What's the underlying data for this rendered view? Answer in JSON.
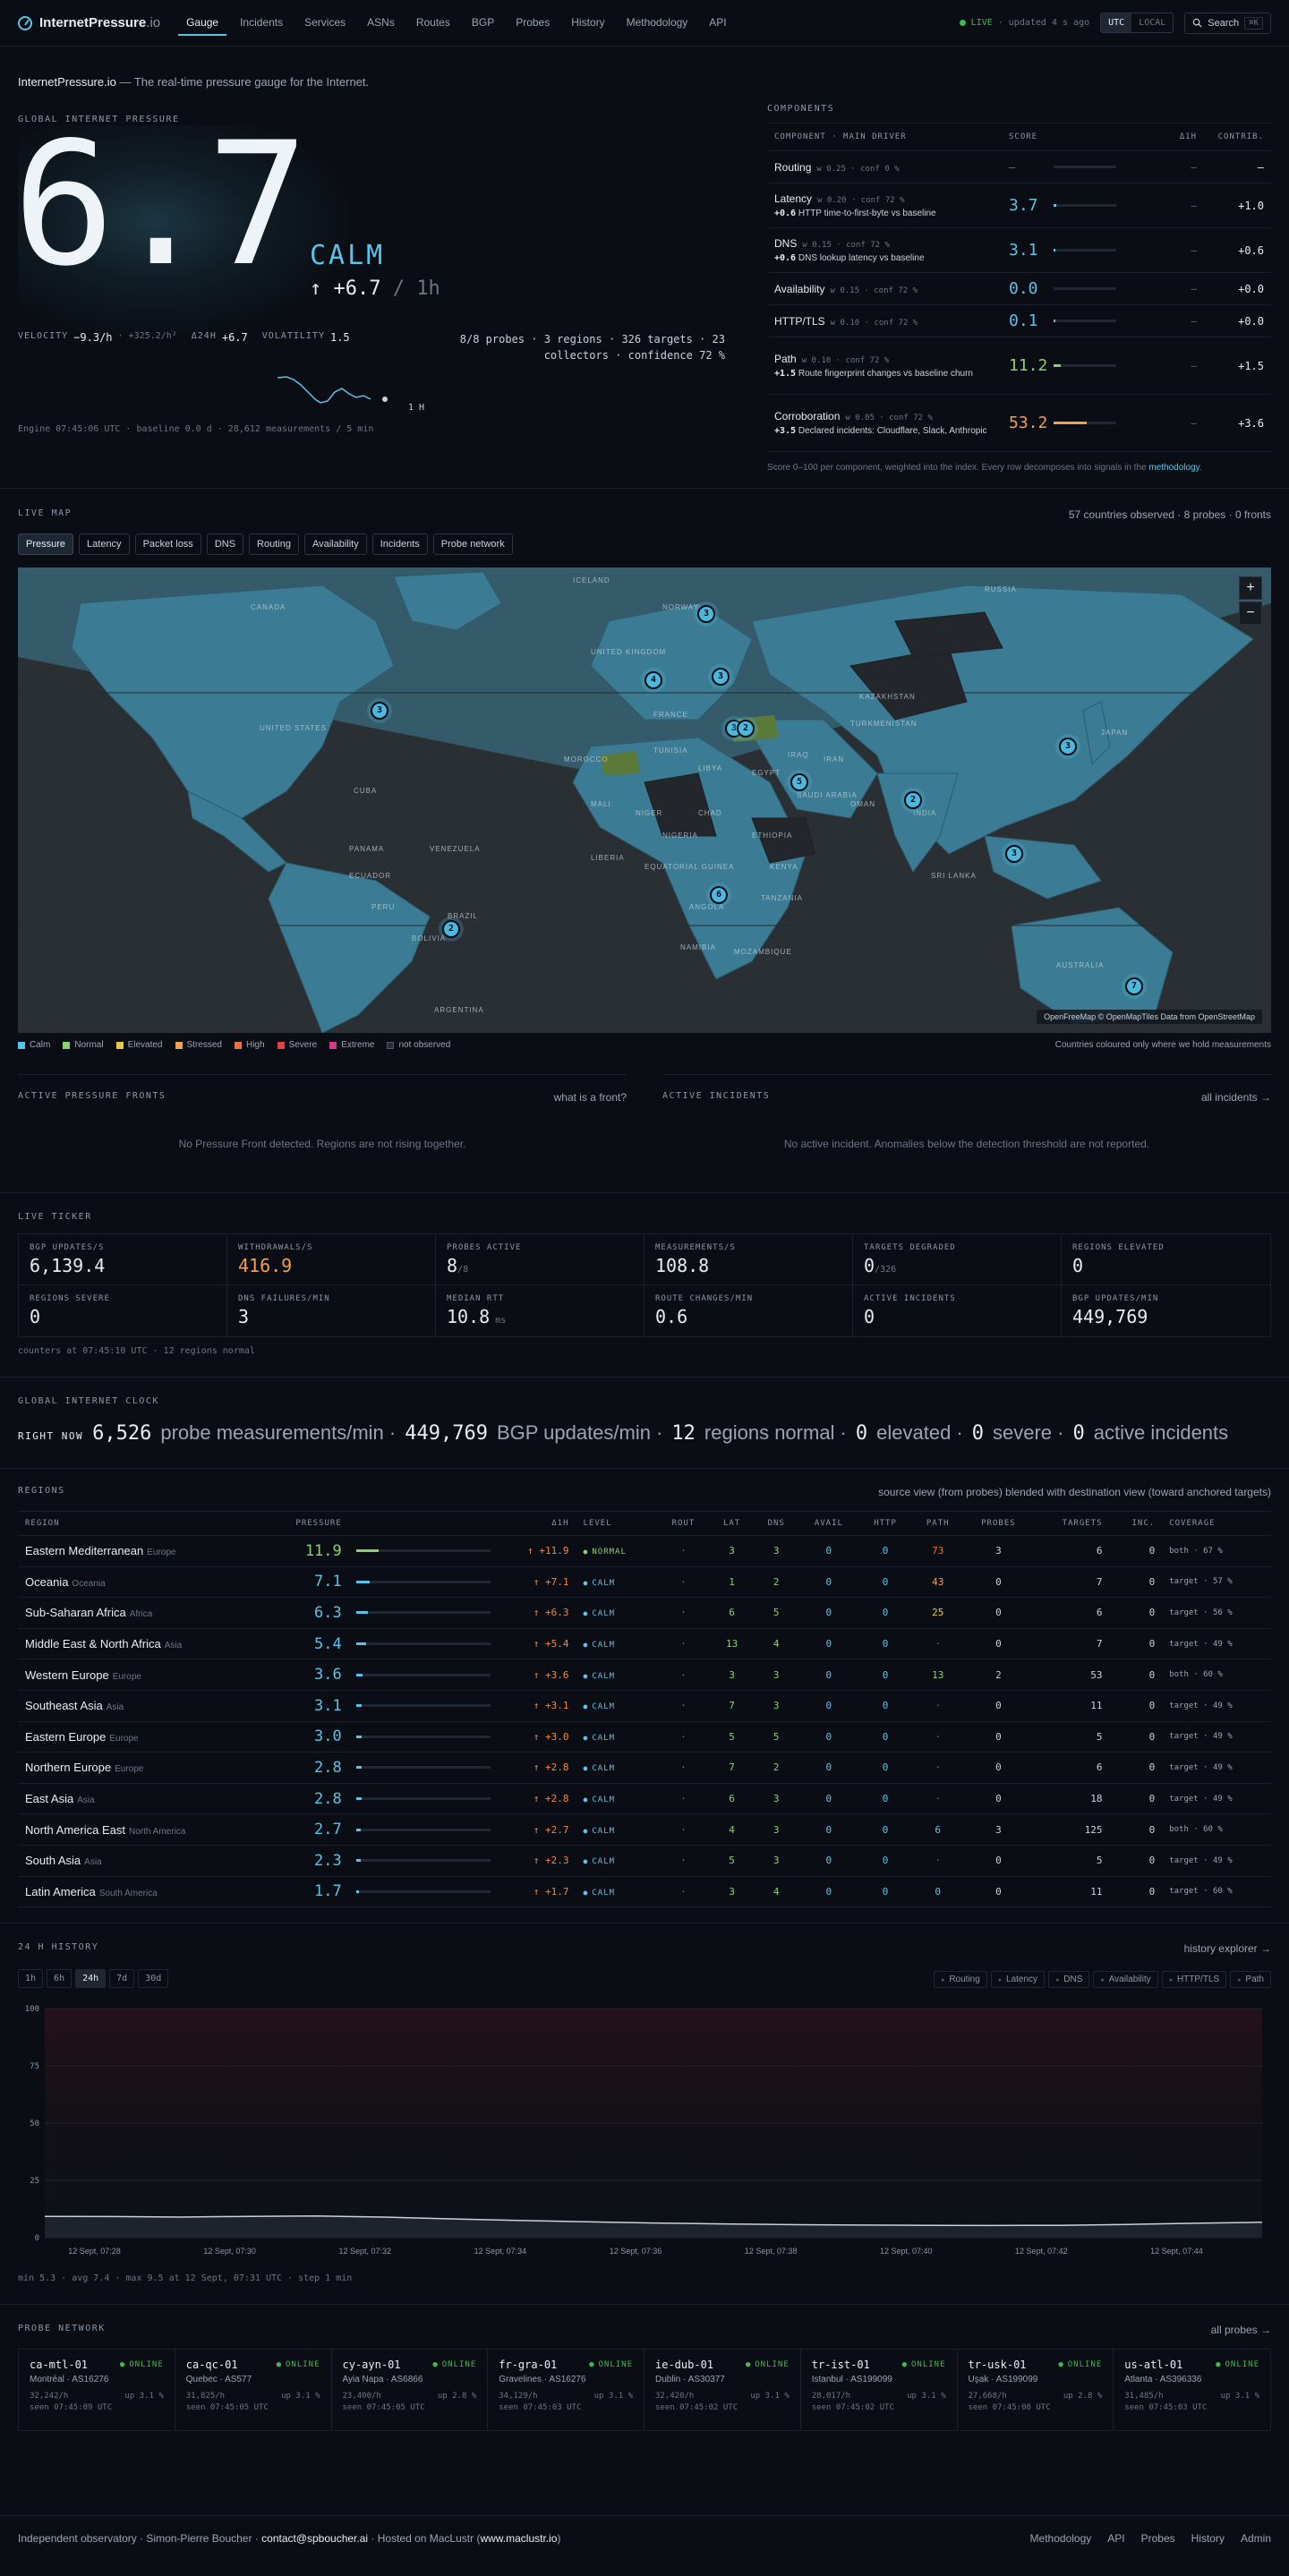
{
  "header": {
    "brand": "InternetPressure",
    "brand_tld": ".io",
    "nav": [
      "Gauge",
      "Incidents",
      "Services",
      "ASNs",
      "Routes",
      "BGP",
      "Probes",
      "History",
      "Methodology",
      "API"
    ],
    "live": "LIVE",
    "updated": "· updated 4 s ago",
    "tz_utc": "UTC",
    "tz_local": "LOCAL",
    "search": "Search",
    "search_kbd": "⌘K"
  },
  "hero": {
    "tagline_brand": "InternetPressure.io",
    "tagline_rest": " — The real-time pressure gauge for the Internet.",
    "title": "GLOBAL INTERNET PRESSURE",
    "score": "6.7",
    "level": "CALM",
    "delta": "↑ +6.7",
    "delta_per": " / 1h",
    "velocity_k": "VELOCITY",
    "velocity_v": "−9.3/h",
    "accel": "· +325.2/h²",
    "d24_k": "Δ24H",
    "d24_v": "+6.7",
    "vol_k": "VOLATILITY",
    "vol_v": "1.5",
    "probes_line1": "8/8 probes · 3 regions · 326 targets · 23",
    "probes_line2": "collectors · confidence 72 %",
    "spark_label": "1 H",
    "engine": "Engine 07:45:06 UTC · baseline 0.0 d · 28,612 measurements / 5 min"
  },
  "components": {
    "title": "COMPONENTS",
    "headers": [
      "COMPONENT · MAIN DRIVER",
      "SCORE",
      "Δ1H",
      "CONTRIB."
    ],
    "rows": [
      {
        "name": "Routing",
        "meta": "w 0.25 · conf 0 %",
        "driver_v": "",
        "driver": "",
        "score": "—",
        "pct": 0,
        "color": "#6b7685",
        "d1h": "—",
        "contrib": "—"
      },
      {
        "name": "Latency",
        "meta": "w 0.20 · conf 72 %",
        "driver_v": "+0.6",
        "driver": " HTTP time-to-first-byte vs baseline",
        "score": "3.7",
        "pct": 3.7,
        "color": "#58c4e8",
        "d1h": "—",
        "contrib": "+1.0"
      },
      {
        "name": "DNS",
        "meta": "w 0.15 · conf 72 %",
        "driver_v": "+0.6",
        "driver": " DNS lookup latency vs baseline",
        "score": "3.1",
        "pct": 3.1,
        "color": "#58c4e8",
        "d1h": "—",
        "contrib": "+0.6"
      },
      {
        "name": "Availability",
        "meta": "w 0.15 · conf 72 %",
        "driver_v": "",
        "driver": "",
        "score": "0.0",
        "pct": 0,
        "color": "#58c4e8",
        "d1h": "—",
        "contrib": "+0.0"
      },
      {
        "name": "HTTP/TLS",
        "meta": "w 0.10 · conf 72 %",
        "driver_v": "",
        "driver": "",
        "score": "0.1",
        "pct": 0.1,
        "color": "#58c4e8",
        "d1h": "—",
        "contrib": "+0.0"
      },
      {
        "name": "Path",
        "meta": "w 0.10 · conf 72 %",
        "driver_v": "+1.5",
        "driver": " Route fingerprint changes vs baseline churn",
        "score": "11.2",
        "pct": 11.2,
        "color": "#8ed06e",
        "d1h": "—",
        "contrib": "+1.5"
      },
      {
        "name": "Corroboration",
        "meta": "w 0.05 · conf 72 %",
        "driver_v": "+3.5",
        "driver": " Declared incidents: Cloudflare, Slack, Anthropic",
        "score": "53.2",
        "pct": 53.2,
        "color": "#f0a050",
        "d1h": "—",
        "contrib": "+3.6"
      }
    ],
    "foot": "Score 0–100 per component, weighted into the index. Every row decomposes into signals in the ",
    "foot_link": "methodology",
    "foot_end": "."
  },
  "map": {
    "title": "LIVE MAP",
    "summary": "57 countries observed · 8 probes · 0 fronts",
    "tabs": [
      "Pressure",
      "Latency",
      "Packet loss",
      "DNS",
      "Routing",
      "Availability",
      "Incidents",
      "Probe network"
    ],
    "labels": [
      "CANADA",
      "UNITED STATES",
      "CUBA",
      "PANAMA",
      "VENEZUELA",
      "ECUADOR",
      "PERU",
      "BRAZIL",
      "BOLIVIA",
      "ARGENTINA",
      "ICELAND",
      "UNITED KINGDOM",
      "NORWAY",
      "FRANCE",
      "TUNISIA",
      "MOROCCO",
      "LIBYA",
      "EGYPT",
      "NIGER",
      "CHAD",
      "MALI",
      "NIGERIA",
      "ETHIOPIA",
      "KENYA",
      "TANZANIA",
      "ANGOLA",
      "NAMIBIA",
      "MOZAMBIQUE",
      "LIBERIA",
      "EQUATORIAL GUINEA",
      "SAUDI ARABIA",
      "IRAN",
      "IRAQ",
      "OMAN",
      "TURKMENISTAN",
      "KAZAKHSTAN",
      "RUSSIA",
      "INDIA",
      "SRI LANKA",
      "JAPAN",
      "AUSTRALIA"
    ],
    "clusters": [
      "3",
      "4",
      "3",
      "3",
      "3",
      "2",
      "5",
      "2",
      "6",
      "2",
      "3",
      "3",
      "7"
    ],
    "zoom_in": "+",
    "zoom_out": "−",
    "attribution": "OpenFreeMap © OpenMapTiles Data from OpenStreetMap",
    "legend": [
      {
        "label": "Calm",
        "color": "#58c4e8"
      },
      {
        "label": "Normal",
        "color": "#8ed06e"
      },
      {
        "label": "Elevated",
        "color": "#e8c84a"
      },
      {
        "label": "Stressed",
        "color": "#f0a050"
      },
      {
        "label": "High",
        "color": "#e8733a"
      },
      {
        "label": "Severe",
        "color": "#e04040"
      },
      {
        "label": "Extreme",
        "color": "#d43a8a"
      },
      {
        "label": "not observed",
        "color": "#2a2f34"
      }
    ],
    "legend_note": "Countries coloured only where we hold measurements"
  },
  "fronts": {
    "title": "ACTIVE PRESSURE FRONTS",
    "link": "what is a front?",
    "empty": "No Pressure Front detected. Regions are not rising together."
  },
  "incidents": {
    "title": "ACTIVE INCIDENTS",
    "link": "all incidents →",
    "empty": "No active incident. Anomalies below the detection threshold are not reported."
  },
  "ticker": {
    "title": "LIVE TICKER",
    "cells": [
      {
        "k": "BGP UPDATES/S",
        "v": "6,139.4",
        "s": "",
        "color": "#e6edf3"
      },
      {
        "k": "WITHDRAWALS/S",
        "v": "416.9",
        "s": "",
        "color": "#f0a050"
      },
      {
        "k": "PROBES ACTIVE",
        "v": "8",
        "s": "/8",
        "color": "#e6edf3"
      },
      {
        "k": "MEASUREMENTS/S",
        "v": "108.8",
        "s": "",
        "color": "#e6edf3"
      },
      {
        "k": "TARGETS DEGRADED",
        "v": "0",
        "s": "/326",
        "color": "#e6edf3"
      },
      {
        "k": "REGIONS ELEVATED",
        "v": "0",
        "s": "",
        "color": "#e6edf3"
      },
      {
        "k": "REGIONS SEVERE",
        "v": "0",
        "s": "",
        "color": "#e6edf3"
      },
      {
        "k": "DNS FAILURES/MIN",
        "v": "3",
        "s": "",
        "color": "#e6edf3"
      },
      {
        "k": "MEDIAN RTT",
        "v": "10.8",
        "s": " ms",
        "color": "#e6edf3"
      },
      {
        "k": "ROUTE CHANGES/MIN",
        "v": "0.6",
        "s": "",
        "color": "#e6edf3"
      },
      {
        "k": "ACTIVE INCIDENTS",
        "v": "0",
        "s": "",
        "color": "#e6edf3"
      },
      {
        "k": "BGP UPDATES/MIN",
        "v": "449,769",
        "s": "",
        "color": "#e6edf3"
      }
    ],
    "foot": "counters at 07:45:10 UTC · 12 regions normal"
  },
  "clock": {
    "title": "GLOBAL INTERNET CLOCK",
    "k": "RIGHT NOW",
    "parts": [
      {
        "n": "6,526",
        "t": "probe measurements/min ·"
      },
      {
        "n": "449,769",
        "t": "BGP updates/min ·"
      },
      {
        "n": "12",
        "t": "regions normal ·"
      },
      {
        "n": "0",
        "t": "elevated ·"
      },
      {
        "n": "0",
        "t": "severe ·"
      },
      {
        "n": "0",
        "t": "active incidents"
      }
    ]
  },
  "regions": {
    "title": "REGIONS",
    "note": "source view (from probes) blended with destination view (toward anchored targets)",
    "headers": [
      "REGION",
      "PRESSURE",
      "",
      "Δ1H",
      "LEVEL",
      "ROUT",
      "LAT",
      "DNS",
      "AVAIL",
      "HTTP",
      "PATH",
      "PROBES",
      "TARGETS",
      "INC.",
      "COVERAGE"
    ],
    "rows": [
      {
        "name": "Eastern Mediterranean",
        "sub": "Europe",
        "p": "11.9",
        "pv": 11.9,
        "pc": "#8ed06e",
        "d": "↑ +11.9",
        "lvl": "NORMAL",
        "lc": "#8ed06e",
        "rout": "·",
        "lat": "3",
        "dns": "3",
        "avail": "0",
        "http": "0",
        "path": "73",
        "pathc": "#e8733a",
        "probes": "3",
        "targets": "6",
        "inc": "0",
        "cov": "both · 67 %"
      },
      {
        "name": "Oceania",
        "sub": "Oceania",
        "p": "7.1",
        "pv": 7.1,
        "pc": "#58c4e8",
        "d": "↑ +7.1",
        "lvl": "CALM",
        "lc": "#58c4e8",
        "rout": "·",
        "lat": "1",
        "dns": "2",
        "avail": "0",
        "http": "0",
        "path": "43",
        "pathc": "#f0a050",
        "probes": "0",
        "targets": "7",
        "inc": "0",
        "cov": "target · 57 %"
      },
      {
        "name": "Sub-Saharan Africa",
        "sub": "Africa",
        "p": "6.3",
        "pv": 6.3,
        "pc": "#58c4e8",
        "d": "↑ +6.3",
        "lvl": "CALM",
        "lc": "#58c4e8",
        "rout": "·",
        "lat": "6",
        "dns": "5",
        "avail": "0",
        "http": "0",
        "path": "25",
        "pathc": "#e8c84a",
        "probes": "0",
        "targets": "6",
        "inc": "0",
        "cov": "target · 56 %"
      },
      {
        "name": "Middle East & North Africa",
        "sub": "Asia",
        "p": "5.4",
        "pv": 5.4,
        "pc": "#58c4e8",
        "d": "↑ +5.4",
        "lvl": "CALM",
        "lc": "#58c4e8",
        "rout": "·",
        "lat": "13",
        "dns": "4",
        "avail": "0",
        "http": "0",
        "path": "·",
        "pathc": "#6b7685",
        "probes": "0",
        "targets": "7",
        "inc": "0",
        "cov": "target · 49 %"
      },
      {
        "name": "Western Europe",
        "sub": "Europe",
        "p": "3.6",
        "pv": 3.6,
        "pc": "#58c4e8",
        "d": "↑ +3.6",
        "lvl": "CALM",
        "lc": "#58c4e8",
        "rout": "·",
        "lat": "3",
        "dns": "3",
        "avail": "0",
        "http": "0",
        "path": "13",
        "pathc": "#8ed06e",
        "probes": "2",
        "targets": "53",
        "inc": "0",
        "cov": "both · 60 %"
      },
      {
        "name": "Southeast Asia",
        "sub": "Asia",
        "p": "3.1",
        "pv": 3.1,
        "pc": "#58c4e8",
        "d": "↑ +3.1",
        "lvl": "CALM",
        "lc": "#58c4e8",
        "rout": "·",
        "lat": "7",
        "dns": "3",
        "avail": "0",
        "http": "0",
        "path": "·",
        "pathc": "#6b7685",
        "probes": "0",
        "targets": "11",
        "inc": "0",
        "cov": "target · 49 %"
      },
      {
        "name": "Eastern Europe",
        "sub": "Europe",
        "p": "3.0",
        "pv": 3.0,
        "pc": "#58c4e8",
        "d": "↑ +3.0",
        "lvl": "CALM",
        "lc": "#58c4e8",
        "rout": "·",
        "lat": "5",
        "dns": "5",
        "avail": "0",
        "http": "0",
        "path": "·",
        "pathc": "#6b7685",
        "probes": "0",
        "targets": "5",
        "inc": "0",
        "cov": "target · 49 %"
      },
      {
        "name": "Northern Europe",
        "sub": "Europe",
        "p": "2.8",
        "pv": 2.8,
        "pc": "#58c4e8",
        "d": "↑ +2.8",
        "lvl": "CALM",
        "lc": "#58c4e8",
        "rout": "·",
        "lat": "7",
        "dns": "2",
        "avail": "0",
        "http": "0",
        "path": "·",
        "pathc": "#6b7685",
        "probes": "0",
        "targets": "6",
        "inc": "0",
        "cov": "target · 49 %"
      },
      {
        "name": "East Asia",
        "sub": "Asia",
        "p": "2.8",
        "pv": 2.8,
        "pc": "#58c4e8",
        "d": "↑ +2.8",
        "lvl": "CALM",
        "lc": "#58c4e8",
        "rout": "·",
        "lat": "6",
        "dns": "3",
        "avail": "0",
        "http": "0",
        "path": "·",
        "pathc": "#6b7685",
        "probes": "0",
        "targets": "18",
        "inc": "0",
        "cov": "target · 49 %"
      },
      {
        "name": "North America East",
        "sub": "North America",
        "p": "2.7",
        "pv": 2.7,
        "pc": "#58c4e8",
        "d": "↑ +2.7",
        "lvl": "CALM",
        "lc": "#58c4e8",
        "rout": "·",
        "lat": "4",
        "dns": "3",
        "avail": "0",
        "http": "0",
        "path": "6",
        "pathc": "#58c4e8",
        "probes": "3",
        "targets": "125",
        "inc": "0",
        "cov": "both · 60 %"
      },
      {
        "name": "South Asia",
        "sub": "Asia",
        "p": "2.3",
        "pv": 2.3,
        "pc": "#58c4e8",
        "d": "↑ +2.3",
        "lvl": "CALM",
        "lc": "#58c4e8",
        "rout": "·",
        "lat": "5",
        "dns": "3",
        "avail": "0",
        "http": "0",
        "path": "·",
        "pathc": "#6b7685",
        "probes": "0",
        "targets": "5",
        "inc": "0",
        "cov": "target · 49 %"
      },
      {
        "name": "Latin America",
        "sub": "South America",
        "p": "1.7",
        "pv": 1.7,
        "pc": "#58c4e8",
        "d": "↑ +1.7",
        "lvl": "CALM",
        "lc": "#58c4e8",
        "rout": "·",
        "lat": "3",
        "dns": "4",
        "avail": "0",
        "http": "0",
        "path": "0",
        "pathc": "#58c4e8",
        "probes": "0",
        "targets": "11",
        "inc": "0",
        "cov": "target · 60 %"
      }
    ]
  },
  "history": {
    "title": "24 H HISTORY",
    "link": "history explorer →",
    "ranges": [
      "1h",
      "6h",
      "24h",
      "7d",
      "30d"
    ],
    "active_range": "24h",
    "series": [
      "Routing",
      "Latency",
      "DNS",
      "Availability",
      "HTTP/TLS",
      "Path"
    ],
    "foot": "min 5.3 · avg 7.4 · max 9.5 at 12 Sept, 07:31 UTC · step 1 min"
  },
  "chart_data": {
    "type": "line",
    "ylim": [
      0,
      100
    ],
    "yticks": [
      "0",
      "25",
      "50",
      "75",
      "100"
    ],
    "xticks": [
      "12 Sept, 07:28",
      "12 Sept, 07:30",
      "12 Sept, 07:32",
      "12 Sept, 07:34",
      "12 Sept, 07:36",
      "12 Sept, 07:38",
      "12 Sept, 07:40",
      "12 Sept, 07:42",
      "12 Sept, 07:44"
    ],
    "x": [
      "07:27",
      "07:28",
      "07:29",
      "07:30",
      "07:31",
      "07:32",
      "07:33",
      "07:34",
      "07:35",
      "07:36",
      "07:37",
      "07:38",
      "07:39",
      "07:40",
      "07:41",
      "07:42",
      "07:43",
      "07:44",
      "07:45"
    ],
    "series": [
      {
        "values": [
          9.3,
          9.2,
          9.0,
          9.3,
          9.5,
          9.0,
          8.2,
          7.5,
          6.9,
          6.4,
          6.0,
          5.7,
          5.5,
          5.4,
          5.3,
          5.4,
          5.8,
          6.3,
          6.7
        ]
      }
    ]
  },
  "probes": {
    "title": "PROBE NETWORK",
    "link": "all probes →",
    "items": [
      {
        "id": "ca-mtl-01",
        "status": "ONLINE",
        "loc": "Montréal · AS16276",
        "rate": "32,242/h",
        "up": "up 3.1 %",
        "seen": "seen 07:45:09 UTC"
      },
      {
        "id": "ca-qc-01",
        "status": "ONLINE",
        "loc": "Quebec · AS577",
        "rate": "31,825/h",
        "up": "up 3.1 %",
        "seen": "seen 07:45:05 UTC"
      },
      {
        "id": "cy-ayn-01",
        "status": "ONLINE",
        "loc": "Ayia Napa · AS6866",
        "rate": "23,400/h",
        "up": "up 2.8 %",
        "seen": "seen 07:45:05 UTC"
      },
      {
        "id": "fr-gra-01",
        "status": "ONLINE",
        "loc": "Gravelines · AS16276",
        "rate": "34,129/h",
        "up": "up 3.1 %",
        "seen": "seen 07:45:03 UTC"
      },
      {
        "id": "ie-dub-01",
        "status": "ONLINE",
        "loc": "Dublin · AS30377",
        "rate": "32,420/h",
        "up": "up 3.1 %",
        "seen": "seen 07:45:02 UTC"
      },
      {
        "id": "tr-ist-01",
        "status": "ONLINE",
        "loc": "Istanbul · AS199099",
        "rate": "28,017/h",
        "up": "up 3.1 %",
        "seen": "seen 07:45:02 UTC"
      },
      {
        "id": "tr-usk-01",
        "status": "ONLINE",
        "loc": "Uşak · AS199099",
        "rate": "27,668/h",
        "up": "up 2.8 %",
        "seen": "seen 07:45:08 UTC"
      },
      {
        "id": "us-atl-01",
        "status": "ONLINE",
        "loc": "Atlanta · AS396336",
        "rate": "31,485/h",
        "up": "up 3.1 %",
        "seen": "seen 07:45:03 UTC"
      }
    ]
  },
  "footer": {
    "left": "Independent observatory · Simon-Pierre Boucher · ",
    "email": "contact@spboucher.ai",
    "mid": " · Hosted on MacLustr (",
    "host": "www.maclustr.io",
    "end": ")",
    "links": [
      "Methodology",
      "API",
      "Probes",
      "History",
      "Admin"
    ]
  }
}
